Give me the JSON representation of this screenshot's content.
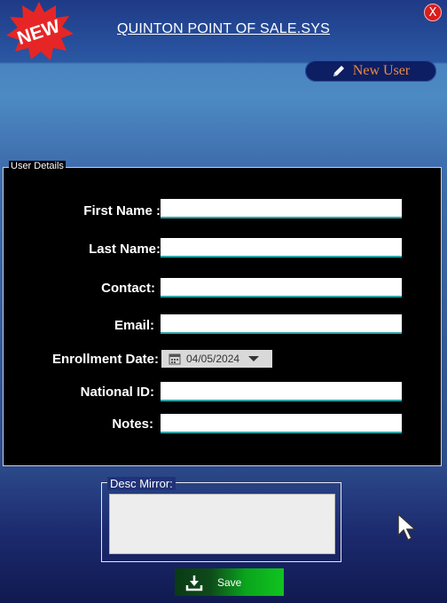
{
  "header": {
    "badge_text": "NEW",
    "title": "QUINTON POINT OF SALE.SYS",
    "close_label": "X"
  },
  "toolbar": {
    "new_user_label": "New User",
    "new_user_icon": "pencil-icon"
  },
  "user_details": {
    "legend": "User Details",
    "fields": {
      "first_name": {
        "label": "First Name :",
        "value": ""
      },
      "last_name": {
        "label": "Last Name:",
        "value": ""
      },
      "contact": {
        "label": "Contact:",
        "value": ""
      },
      "email": {
        "label": "Email:",
        "value": ""
      },
      "enrollment_date": {
        "label": "Enrollment Date:",
        "value": "04/05/2024"
      },
      "national_id": {
        "label": "National ID:",
        "value": ""
      },
      "notes": {
        "label": "Notes:",
        "value": ""
      }
    }
  },
  "desc_mirror": {
    "legend": "Desc Mirror:",
    "value": ""
  },
  "save_button": {
    "label": "Save",
    "icon": "download-icon"
  },
  "colors": {
    "accent_orange": "#f08a3c",
    "save_green": "#10c41f",
    "input_underline": "#2aa6a6",
    "close_red": "#d81e1e"
  }
}
